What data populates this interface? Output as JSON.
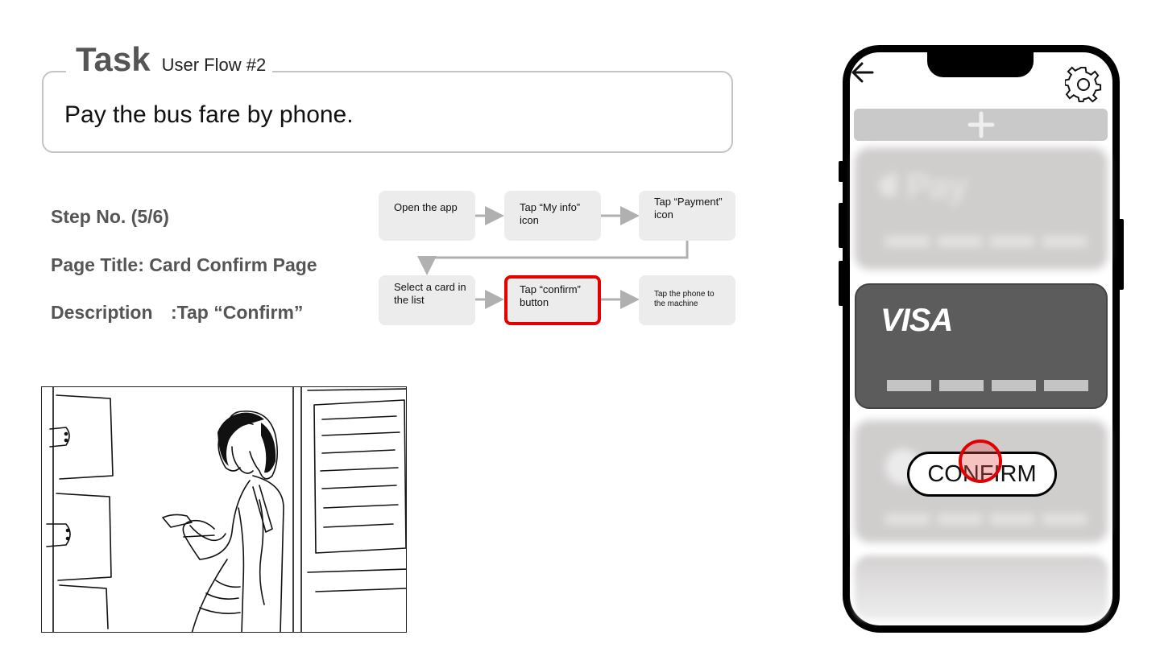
{
  "task": {
    "title": "Task",
    "subtitle": "User Flow #2",
    "text": "Pay the bus fare by phone."
  },
  "info": {
    "step": "Step No. (5/6)",
    "page_title": "Page Title: Card Confirm Page",
    "description_label": "Description",
    "description_value": ":Tap “Confirm”"
  },
  "flow": {
    "steps": [
      "Open the app",
      "Tap  “My info” icon",
      "Tap “Payment” icon",
      "Select a card in the list",
      "Tap “confirm” button",
      "Tap the phone to the machine"
    ],
    "highlight_color": "#e50000",
    "current_step": 5
  },
  "phone": {
    "cards": {
      "apple_pay": "Pay",
      "visa": "VISA"
    },
    "confirm_label": "CONFIRM",
    "icons": [
      "back-arrow-icon",
      "gear-icon",
      "plus-icon",
      "apple-logo-icon"
    ],
    "tap_indicator_color": "#e00000"
  }
}
